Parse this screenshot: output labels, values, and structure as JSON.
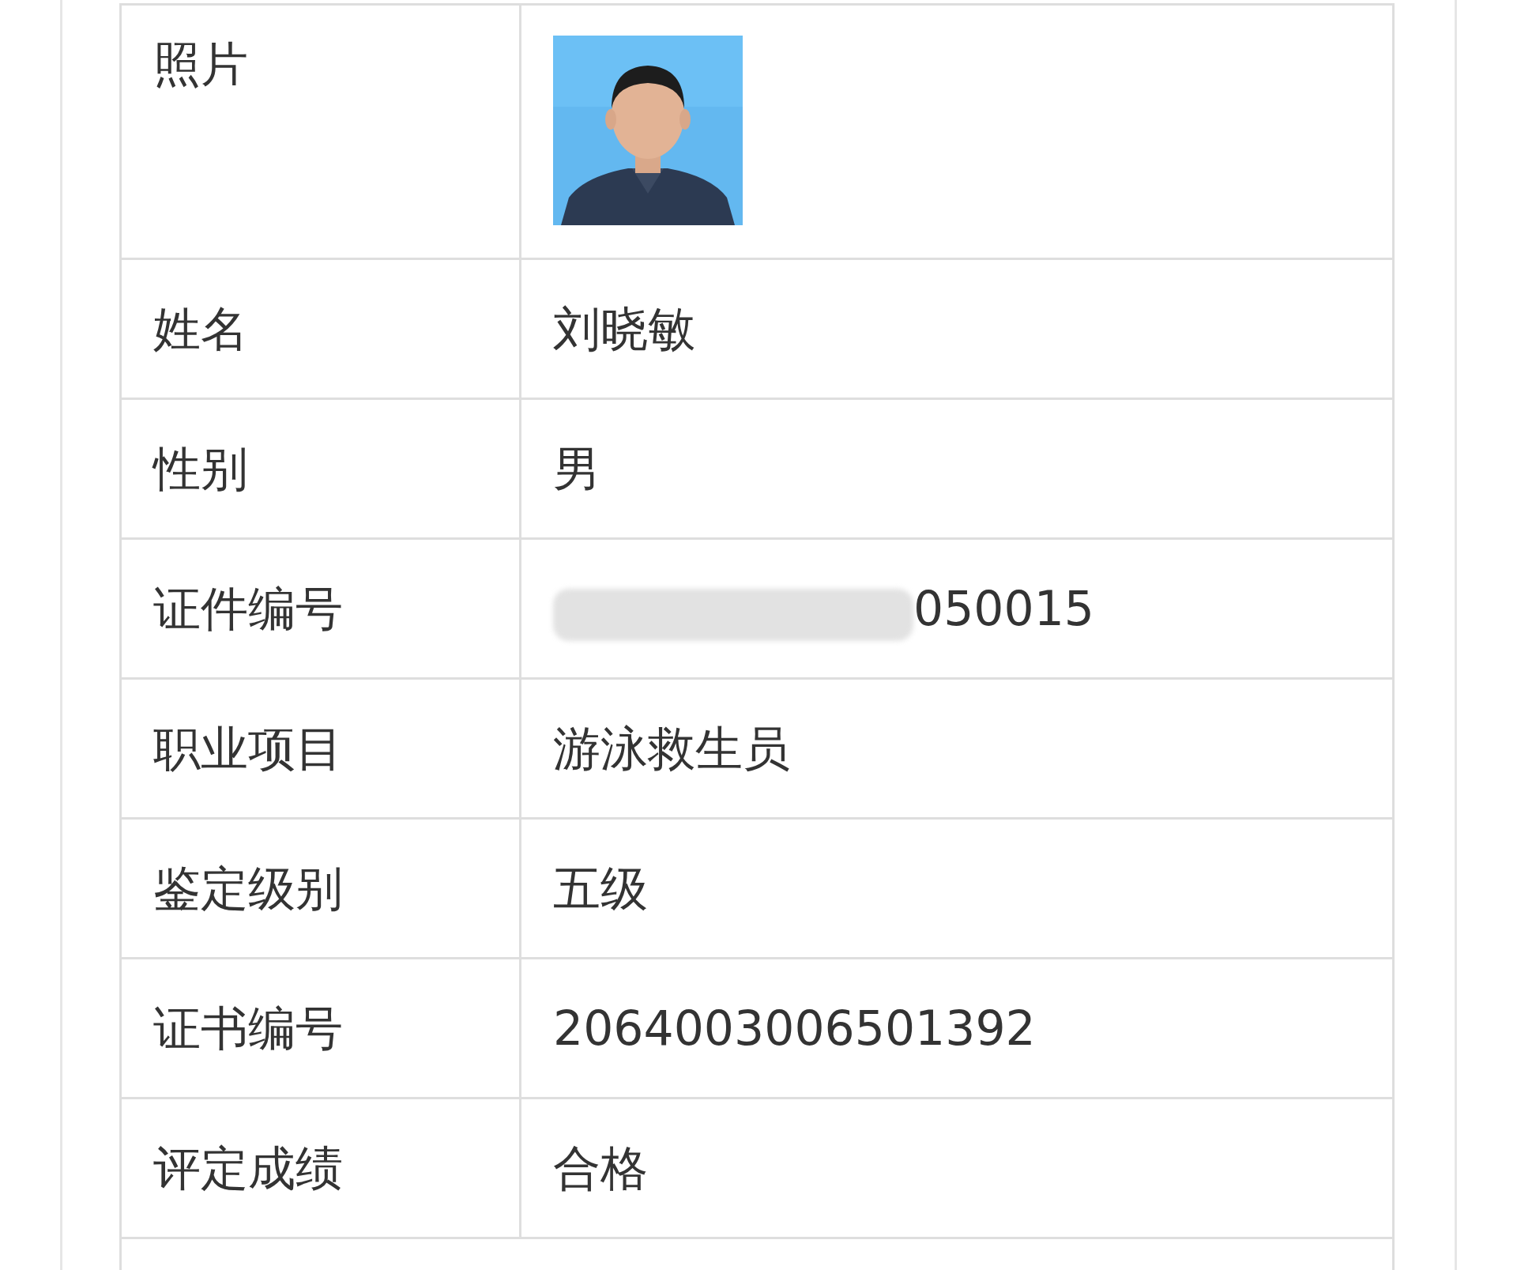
{
  "rows": [
    {
      "label": "照片"
    },
    {
      "kind": "text",
      "label": "姓名",
      "value": "刘晓敏"
    },
    {
      "kind": "text",
      "label": "性别",
      "value": "男"
    },
    {
      "kind": "redacted",
      "label": "证件编号",
      "value": "050015"
    },
    {
      "kind": "text",
      "label": "职业项目",
      "value": "游泳救生员"
    },
    {
      "kind": "text",
      "label": "鉴定级别",
      "value": "五级"
    },
    {
      "kind": "text",
      "label": "证书编号",
      "value": "2064003006501392"
    },
    {
      "kind": "text",
      "label": "评定成绩",
      "value": "合格"
    }
  ]
}
